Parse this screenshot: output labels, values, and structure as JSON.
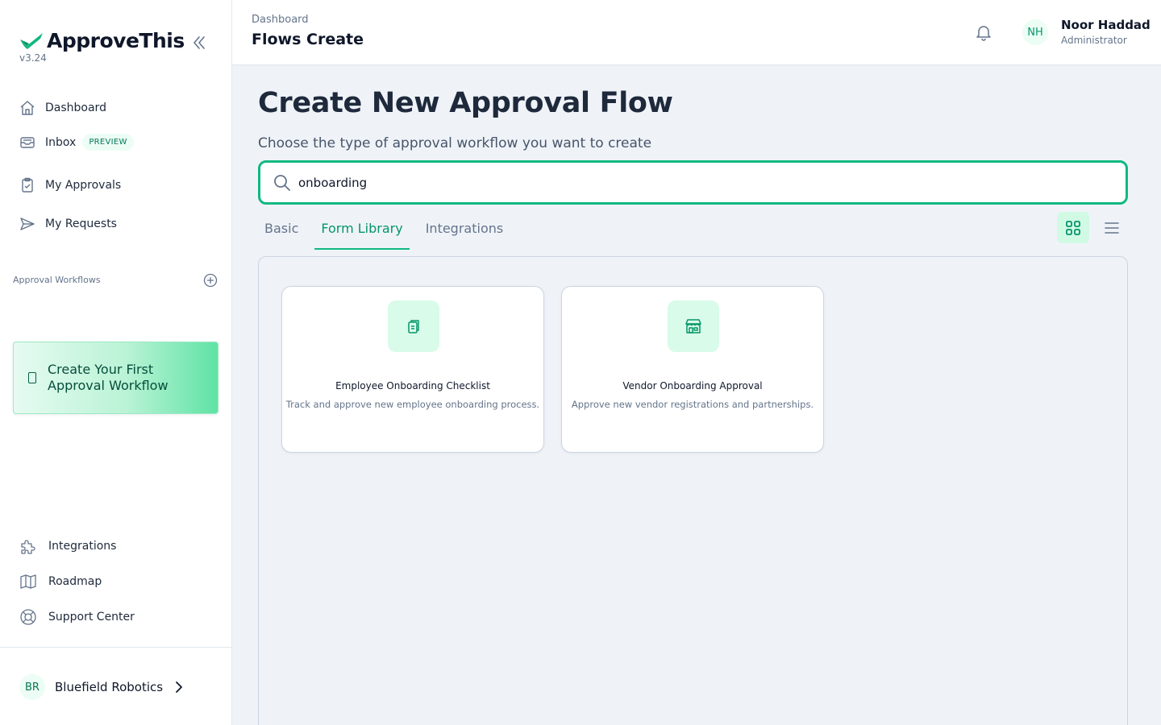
{
  "brand": {
    "name": "ApproveThis",
    "version": "v3.24"
  },
  "sidebar": {
    "items": [
      {
        "label": "Dashboard"
      },
      {
        "label": "Inbox",
        "badge": "PREVIEW"
      },
      {
        "label": "My Approvals"
      },
      {
        "label": "My Requests"
      }
    ],
    "section_title": "Approval Workflows",
    "create_first": "Create Your First Approval Workflow",
    "bottom_items": [
      {
        "label": "Integrations"
      },
      {
        "label": "Roadmap"
      },
      {
        "label": "Support Center"
      }
    ],
    "org": {
      "initials": "BR",
      "name": "Bluefield Robotics"
    }
  },
  "header": {
    "breadcrumb": "Dashboard",
    "title": "Flows Create",
    "user": {
      "initials": "NH",
      "name": "Noor Haddad",
      "role": "Administrator"
    }
  },
  "main": {
    "heading": "Create New Approval Flow",
    "subtitle": "Choose the type of approval workflow you want to create",
    "search_value": "onboarding",
    "tabs": [
      {
        "label": "Basic",
        "active": false
      },
      {
        "label": "Form Library",
        "active": true
      },
      {
        "label": "Integrations",
        "active": false
      }
    ],
    "view_mode": "grid",
    "cards": [
      {
        "title": "Employee Onboarding Checklist",
        "description": "Track and approve new employee onboarding process.",
        "icon": "clipboard-icon"
      },
      {
        "title": "Vendor Onboarding Approval",
        "description": "Approve new vendor registrations and partnerships.",
        "icon": "store-icon"
      }
    ]
  },
  "colors": {
    "accent": "#10b981",
    "accent_dark": "#059669",
    "bg": "#eff3f8"
  }
}
